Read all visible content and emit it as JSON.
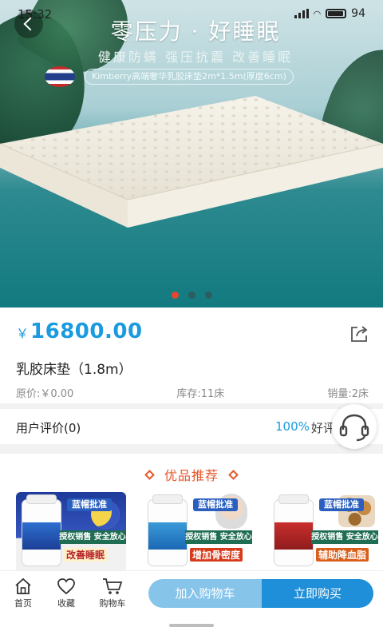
{
  "status_bar": {
    "time": "15:32",
    "battery": "94"
  },
  "banner": {
    "headline": "零压力 · 好睡眠",
    "subline": "健康防螨   强压抗震   改善睡眠",
    "product_spec": "Kimberry高端奢华乳胶床垫2m*1.5m(厚度6cm)",
    "slides": 3,
    "active_slide": 0
  },
  "product": {
    "currency": "￥",
    "price": "16800.00",
    "title": "乳胶床垫（1.8m）",
    "original_price": "原价:￥0.00",
    "stock": "库存:11床",
    "sales": "销量:2床"
  },
  "review": {
    "label": "用户评价(0)",
    "rate": "100%",
    "rate_word": "好评"
  },
  "recommend": {
    "title": "优品推荐",
    "items": [
      {
        "badge": "蓝帽批准",
        "strip": "授权销售 安全放心",
        "tag": "改善睡眠"
      },
      {
        "badge": "蓝帽批准",
        "strip": "授权销售 安全放心",
        "tag": "增加骨密度"
      },
      {
        "badge": "蓝帽批准",
        "strip": "授权销售 安全放心",
        "tag": "辅助降血脂"
      }
    ]
  },
  "bottom_bar": {
    "home": "首页",
    "favorite": "收藏",
    "cart": "购物车",
    "add_to_cart": "加入购物车",
    "buy_now": "立即购买"
  },
  "colors": {
    "price": "#1a9be0",
    "accent": "#e6562a",
    "buy": "#1e8fd8",
    "add_to_cart": "#86c4ea"
  },
  "icons": [
    "back-icon",
    "share-icon",
    "customer-service-icon",
    "home-icon",
    "heart-icon",
    "cart-icon"
  ]
}
